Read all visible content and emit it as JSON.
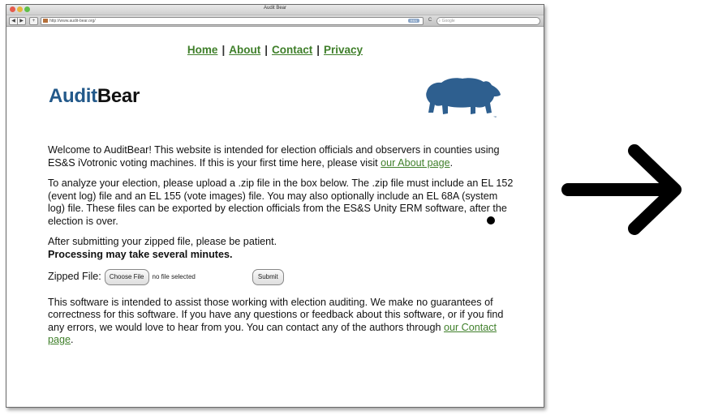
{
  "window": {
    "title": "Audit Bear",
    "url": "http://www.audit-bear.org/",
    "rss_label": "RSS",
    "search_placeholder": "Google",
    "nav": {
      "back": "◀",
      "forward": "▶",
      "add": "+",
      "reload": "C"
    }
  },
  "topnav": {
    "items": [
      {
        "label": "Home"
      },
      {
        "label": "About"
      },
      {
        "label": "Contact"
      },
      {
        "label": "Privacy"
      }
    ],
    "separator": "|"
  },
  "logo": {
    "part1": "Audit",
    "part2": "Bear"
  },
  "content": {
    "p1_text": "Welcome to AuditBear! This website is intended for election officials and observers in counties using ES&S iVotronic voting machines. If this is your first time here, please visit ",
    "p1_link": "our About page",
    "p1_end": ".",
    "p2": "To analyze your election, please upload a .zip file in the box below. The .zip file must include an EL 152 (event log) file and an EL 155 (vote images) file. You may also optionally include an EL 68A (system log) file. These files can be exported by election officials from the ES&S Unity ERM software, after the election is over.",
    "p3_line1": "After submitting your zipped file, please be patient.",
    "p3_line2": "Processing may take several minutes.",
    "file_label": "Zipped File:",
    "choose_button": "Choose File",
    "no_file_text": "no file selected",
    "submit_button": "Submit",
    "p4_text": "This software is intended to assist those working with election auditing. We make no guarantees of correctness for this software. If you have any questions or feedback about this software, or if you find any errors, we would love to hear from you. You can contact any of the authors through ",
    "p4_link": "our Contact page",
    "p4_end": "."
  },
  "colors": {
    "logo_blue": "#23598a",
    "link_green": "#3f7f2a",
    "bear_blue": "#2e5f8f"
  }
}
